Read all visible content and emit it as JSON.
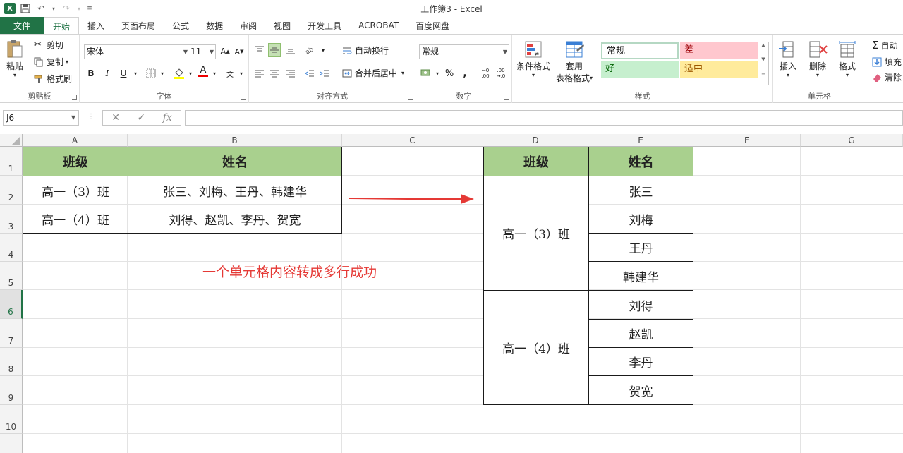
{
  "app": {
    "title": "工作簿3 - Excel",
    "logo": "X"
  },
  "tabs": [
    {
      "label": "文件"
    },
    {
      "label": "开始"
    },
    {
      "label": "插入"
    },
    {
      "label": "页面布局"
    },
    {
      "label": "公式"
    },
    {
      "label": "数据"
    },
    {
      "label": "审阅"
    },
    {
      "label": "视图"
    },
    {
      "label": "开发工具"
    },
    {
      "label": "ACROBAT"
    },
    {
      "label": "百度网盘"
    }
  ],
  "ribbon": {
    "clipboard": {
      "label": "剪贴板",
      "paste": "粘贴",
      "cut": "剪切",
      "copy": "复制",
      "painter": "格式刷"
    },
    "font": {
      "label": "字体",
      "name": "宋体",
      "size": "11",
      "bold": "B",
      "italic": "I",
      "underline": "U"
    },
    "align": {
      "label": "对齐方式",
      "wrap": "自动换行",
      "merge": "合并后居中"
    },
    "number": {
      "label": "数字",
      "format": "常规",
      "percent": "%",
      "comma": ","
    },
    "styles": {
      "label": "样式",
      "cond": "条件格式",
      "table_line1": "套用",
      "table_line2": "表格格式",
      "normal": "常规",
      "bad": "差",
      "good": "好",
      "neutral": "适中"
    },
    "cells": {
      "label": "单元格",
      "insert": "插入",
      "delete": "删除",
      "format": "格式"
    },
    "editing": {
      "autosum": "自动",
      "fill": "填充",
      "clear": "清除"
    }
  },
  "formula_bar": {
    "name_box": "J6",
    "fx": "fx",
    "value": ""
  },
  "columns": [
    "A",
    "B",
    "C",
    "D",
    "E",
    "F",
    "G"
  ],
  "rows": [
    "1",
    "2",
    "3",
    "4",
    "5",
    "6",
    "7",
    "8",
    "9",
    "10"
  ],
  "left_table": {
    "headers": [
      "班级",
      "姓名"
    ],
    "rows": [
      [
        "高一（3）班",
        "张三、刘梅、王丹、韩建华"
      ],
      [
        "高一（4）班",
        "刘得、赵凯、李丹、贺宽"
      ]
    ]
  },
  "right_table": {
    "headers": [
      "班级",
      "姓名"
    ],
    "groups": [
      {
        "class": "高一（3）班",
        "names": [
          "张三",
          "刘梅",
          "王丹",
          "韩建华"
        ]
      },
      {
        "class": "高一（4）班",
        "names": [
          "刘得",
          "赵凯",
          "李丹",
          "贺宽"
        ]
      }
    ]
  },
  "annotation": "一个单元格内容转成多行成功",
  "colors": {
    "excel_green": "#217346",
    "header_fill": "#a9d08e",
    "annotation": "#e53935"
  }
}
